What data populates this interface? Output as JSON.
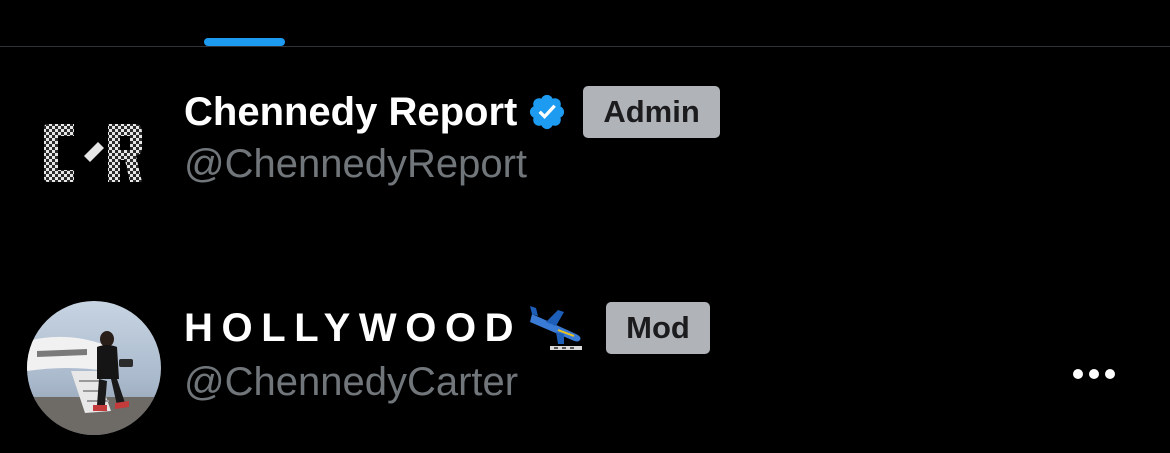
{
  "tabs": {
    "active_indicator_color": "#1d9bf0"
  },
  "members": [
    {
      "display_name": "Chennedy Report",
      "handle": "@ChennedyReport",
      "verified": true,
      "role": "Admin",
      "avatar": "chennedy-report-logo",
      "logo_text": "C/R"
    },
    {
      "display_name": "HOLLYWOOD",
      "handle": "@ChennedyCarter",
      "verified": false,
      "name_emoji": "airplane-arriving-icon",
      "role": "Mod",
      "avatar": "profile-photo"
    }
  ],
  "colors": {
    "background": "#000000",
    "name": "#ffffff",
    "handle": "#71767b",
    "badge_bg": "#b0b3b8",
    "badge_text": "#1c1c1e",
    "verified": "#1d9bf0",
    "divider": "#2f3336"
  },
  "more_menu_icon": "more-horizontal-icon"
}
